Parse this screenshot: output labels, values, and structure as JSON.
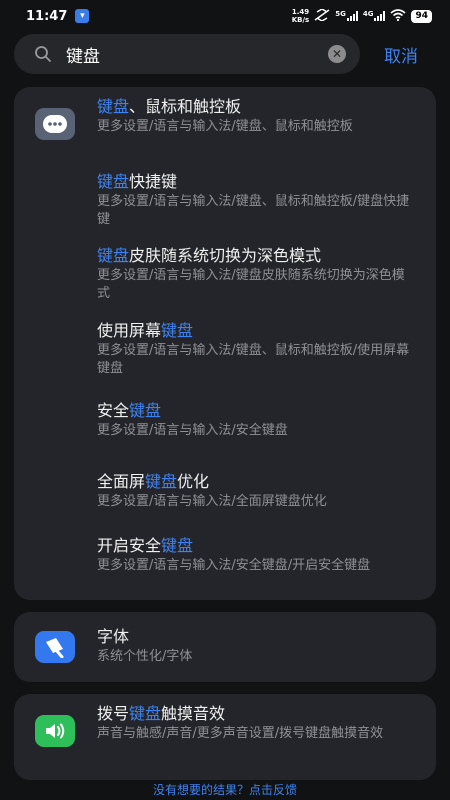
{
  "status_bar": {
    "time": "11:47",
    "net_speed_value": "1.49",
    "net_speed_unit": "KB/s",
    "sig1_label": "5G",
    "sig2_label": "4G",
    "battery": "94"
  },
  "search": {
    "query": "键盘",
    "cancel_label": "取消"
  },
  "results": [
    {
      "pre": "",
      "hl": "键盘",
      "post": "、鼠标和触控板",
      "path": "更多设置/语言与输入法/键盘、鼠标和触控板"
    },
    {
      "pre": "",
      "hl": "键盘",
      "post": "快捷键",
      "path": "更多设置/语言与输入法/键盘、鼠标和触控板/键盘快捷键"
    },
    {
      "pre": "",
      "hl": "键盘",
      "post": "皮肤随系统切换为深色模式",
      "path": "更多设置/语言与输入法/键盘皮肤随系统切换为深色模式"
    },
    {
      "pre": "使用屏幕",
      "hl": "键盘",
      "post": "",
      "path": "更多设置/语言与输入法/键盘、鼠标和触控板/使用屏幕键盘"
    },
    {
      "pre": "安全",
      "hl": "键盘",
      "post": "",
      "path": "更多设置/语言与输入法/安全键盘"
    },
    {
      "pre": "全面屏",
      "hl": "键盘",
      "post": "优化",
      "path": "更多设置/语言与输入法/全面屏键盘优化"
    },
    {
      "pre": "开启安全",
      "hl": "键盘",
      "post": "",
      "path": "更多设置/语言与输入法/安全键盘/开启安全键盘"
    },
    {
      "pre": "字体",
      "hl": "",
      "post": "",
      "path": "系统个性化/字体"
    },
    {
      "pre": "拨号",
      "hl": "键盘",
      "post": "触摸音效",
      "path": "声音与触感/声音/更多声音设置/拨号键盘触摸音效"
    }
  ],
  "feedback_label": "没有想要的结果？点击反馈",
  "colors": {
    "accent": "#3f83f0",
    "keyboard_icon_bg": "#5a6275",
    "font_icon_bg": "#3478f0",
    "sound_icon_bg": "#2fbf5a"
  }
}
